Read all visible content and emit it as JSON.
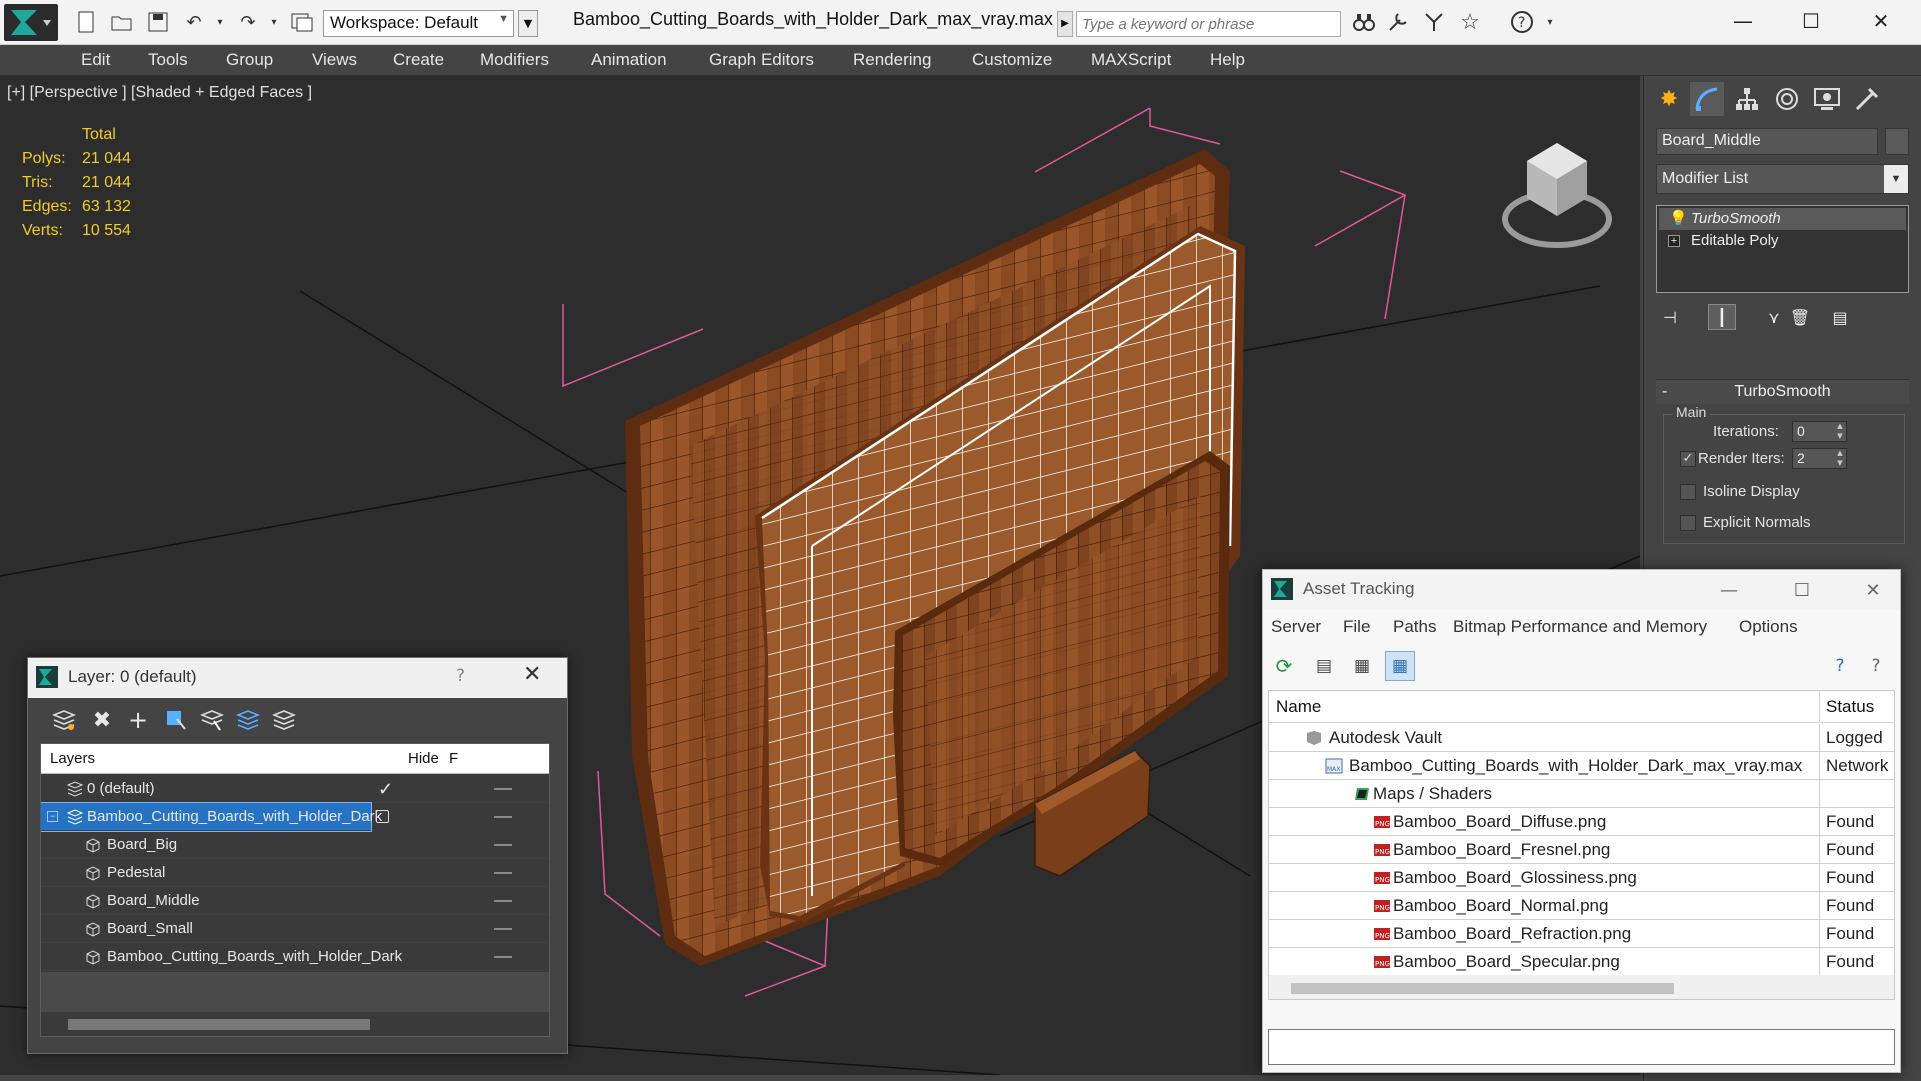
{
  "titlebar": {
    "workspace": "Workspace: Default",
    "file_title": "Bamboo_Cutting_Boards_with_Holder_Dark_max_vray.max",
    "search_placeholder": "Type a keyword or phrase"
  },
  "menu": [
    "Edit",
    "Tools",
    "Group",
    "Views",
    "Create",
    "Modifiers",
    "Animation",
    "Graph Editors",
    "Rendering",
    "Customize",
    "MAXScript",
    "Help"
  ],
  "viewport": {
    "label": "[+] [Perspective ] [Shaded + Edged Faces ]",
    "stats": {
      "header": "Total",
      "rows": [
        {
          "label": "Polys:",
          "value": "21 044"
        },
        {
          "label": "Tris:",
          "value": "21 044"
        },
        {
          "label": "Edges:",
          "value": "63 132"
        },
        {
          "label": "Verts:",
          "value": "10 554"
        }
      ]
    }
  },
  "command_panel": {
    "object_name": "Board_Middle",
    "modifier_list": "Modifier List",
    "stack": [
      "TurboSmooth",
      "Editable Poly"
    ],
    "rollout": {
      "title": "TurboSmooth",
      "group": "Main",
      "iterations_label": "Iterations:",
      "iterations": "0",
      "render_iters_label": "Render Iters:",
      "render_iters": "2",
      "isoline_label": "Isoline Display",
      "explicit_label": "Explicit Normals"
    }
  },
  "layer_dialog": {
    "title": "Layer: 0 (default)",
    "help": "?",
    "headers": {
      "layers": "Layers",
      "hide": "Hide",
      "freeze": "F"
    },
    "rows": [
      {
        "name": "0 (default)",
        "level": 0
      },
      {
        "name": "Bamboo_Cutting_Boards_with_Holder_Dark",
        "level": 0
      },
      {
        "name": "Board_Big",
        "level": 1
      },
      {
        "name": "Pedestal",
        "level": 1
      },
      {
        "name": "Board_Middle",
        "level": 1
      },
      {
        "name": "Board_Small",
        "level": 1
      },
      {
        "name": "Bamboo_Cutting_Boards_with_Holder_Dark",
        "level": 1
      }
    ]
  },
  "asset_tracking": {
    "title": "Asset Tracking",
    "menu": [
      "Server",
      "File",
      "Paths",
      "Bitmap Performance and Memory",
      "Options"
    ],
    "headers": {
      "name": "Name",
      "status": "Status"
    },
    "rows": [
      {
        "name": "Autodesk Vault",
        "status": "Logged"
      },
      {
        "name": "Bamboo_Cutting_Boards_with_Holder_Dark_max_vray.max",
        "status": "Network"
      },
      {
        "name": "Maps / Shaders",
        "status": ""
      },
      {
        "name": "Bamboo_Board_Diffuse.png",
        "status": "Found"
      },
      {
        "name": "Bamboo_Board_Fresnel.png",
        "status": "Found"
      },
      {
        "name": "Bamboo_Board_Glossiness.png",
        "status": "Found"
      },
      {
        "name": "Bamboo_Board_Normal.png",
        "status": "Found"
      },
      {
        "name": "Bamboo_Board_Refraction.png",
        "status": "Found"
      },
      {
        "name": "Bamboo_Board_Specular.png",
        "status": "Found"
      }
    ]
  },
  "colors": {
    "stats_yellow": "#f1cd25",
    "selection_blue": "#2673c4",
    "bbox_pink": "#e0589b",
    "wood": "#8a4a22"
  }
}
